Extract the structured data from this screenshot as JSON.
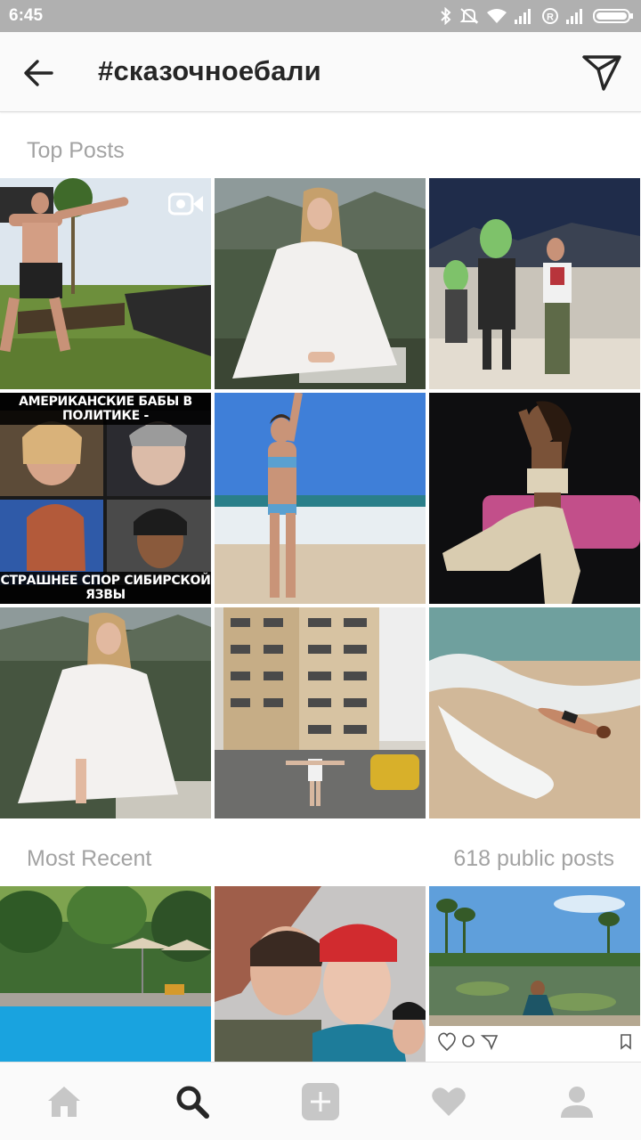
{
  "status_bar": {
    "time": "6:45",
    "icons": [
      "bluetooth-icon",
      "mute-icon",
      "wifi-icon",
      "signal-icon",
      "r-icon",
      "signal-icon",
      "battery-icon"
    ]
  },
  "header": {
    "title": "#сказочноебали",
    "back_icon": "arrow-left-icon",
    "direct_icon": "paper-plane-icon"
  },
  "top_posts": {
    "label": "Top Posts",
    "items": [
      {
        "name": "man-by-pool",
        "has_video": true
      },
      {
        "name": "woman-white-dress-mountains"
      },
      {
        "name": "alien-graffiti-man"
      },
      {
        "name": "politics-meme",
        "caption_top": "АМЕРИКАНСКИЕ БАБЫ В ПОЛИТИКЕ -",
        "caption_bottom": "СТРАШНЕЕ СПОР СИБИРСКОЙ ЯЗВЫ"
      },
      {
        "name": "woman-bikini-beach"
      },
      {
        "name": "woman-crochet-outfit"
      },
      {
        "name": "woman-white-dress-sitting"
      },
      {
        "name": "woman-apartment-blocks"
      },
      {
        "name": "woman-lying-surf"
      }
    ]
  },
  "most_recent": {
    "label": "Most Recent",
    "count_text": "618 public posts",
    "items": [
      {
        "name": "tropical-pool"
      },
      {
        "name": "two-women-selfie"
      },
      {
        "name": "woman-meditating-lake"
      }
    ]
  },
  "bottom_nav": {
    "items": [
      "home-icon",
      "search-icon",
      "add-post-icon",
      "heart-icon",
      "profile-icon"
    ],
    "active": "search-icon"
  },
  "colors": {
    "status_bar": "#b0b0b0",
    "header_bg": "#fafafa",
    "section_label": "#a3a3a3",
    "nav_inactive": "#c7c7c7",
    "nav_active": "#262626"
  }
}
